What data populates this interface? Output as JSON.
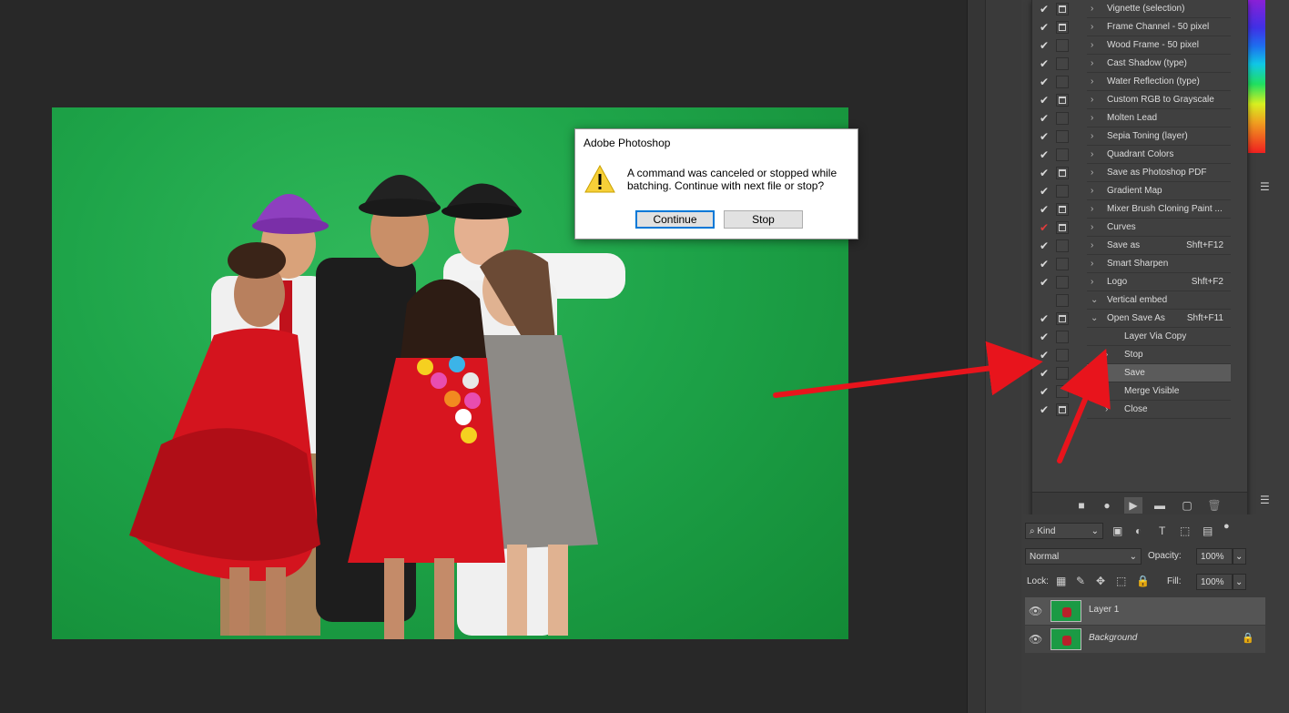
{
  "dialog": {
    "title": "Adobe Photoshop",
    "message": "A command was canceled or stopped while batching. Continue with next file or stop?",
    "continue_label": "Continue",
    "stop_label": "Stop"
  },
  "actions": [
    {
      "label": "Vignette (selection)",
      "shortcut": "",
      "check": true,
      "dialog": true,
      "arrow": "›",
      "indent": 0
    },
    {
      "label": "Frame Channel - 50 pixel",
      "shortcut": "",
      "check": true,
      "dialog": true,
      "arrow": "›",
      "indent": 0
    },
    {
      "label": "Wood Frame - 50 pixel",
      "shortcut": "",
      "check": true,
      "dialog": false,
      "arrow": "›",
      "indent": 0
    },
    {
      "label": "Cast Shadow (type)",
      "shortcut": "",
      "check": true,
      "dialog": false,
      "arrow": "›",
      "indent": 0
    },
    {
      "label": "Water Reflection (type)",
      "shortcut": "",
      "check": true,
      "dialog": false,
      "arrow": "›",
      "indent": 0
    },
    {
      "label": "Custom RGB to Grayscale",
      "shortcut": "",
      "check": true,
      "dialog": true,
      "arrow": "›",
      "indent": 0
    },
    {
      "label": "Molten Lead",
      "shortcut": "",
      "check": true,
      "dialog": false,
      "arrow": "›",
      "indent": 0
    },
    {
      "label": "Sepia Toning (layer)",
      "shortcut": "",
      "check": true,
      "dialog": false,
      "arrow": "›",
      "indent": 0
    },
    {
      "label": "Quadrant Colors",
      "shortcut": "",
      "check": true,
      "dialog": false,
      "arrow": "›",
      "indent": 0
    },
    {
      "label": "Save as Photoshop PDF",
      "shortcut": "",
      "check": true,
      "dialog": true,
      "arrow": "›",
      "indent": 0
    },
    {
      "label": "Gradient Map",
      "shortcut": "",
      "check": true,
      "dialog": false,
      "arrow": "›",
      "indent": 0
    },
    {
      "label": "Mixer Brush Cloning Paint ...",
      "shortcut": "",
      "check": true,
      "dialog": true,
      "arrow": "›",
      "indent": 0
    },
    {
      "label": "Curves",
      "shortcut": "",
      "check": true,
      "checkRed": true,
      "dialog": true,
      "arrow": "›",
      "indent": 0
    },
    {
      "label": "Save as",
      "shortcut": "Shft+F12",
      "check": true,
      "dialog": false,
      "arrow": "›",
      "indent": 0
    },
    {
      "label": "Smart Sharpen",
      "shortcut": "",
      "check": true,
      "dialog": false,
      "arrow": "›",
      "indent": 0
    },
    {
      "label": "Logo",
      "shortcut": "Shft+F2",
      "check": true,
      "dialog": false,
      "arrow": "›",
      "indent": 0
    },
    {
      "label": "Vertical embed",
      "shortcut": "",
      "check": false,
      "dialog": false,
      "arrow": "⌄",
      "indent": 0
    },
    {
      "label": "Open Save As",
      "shortcut": "Shft+F11",
      "check": true,
      "dialog": true,
      "arrow": "⌄",
      "indent": 0
    },
    {
      "label": "Layer Via Copy",
      "shortcut": "",
      "check": true,
      "dialog": false,
      "arrow": "",
      "indent": 1
    },
    {
      "label": "Stop",
      "shortcut": "",
      "check": true,
      "dialog": false,
      "arrow": "›",
      "indent": 1
    },
    {
      "label": "Save",
      "shortcut": "",
      "check": true,
      "dialog": false,
      "arrow": "›",
      "indent": 1,
      "selected": true
    },
    {
      "label": "Merge Visible",
      "shortcut": "",
      "check": true,
      "dialog": false,
      "arrow": "",
      "indent": 1
    },
    {
      "label": "Close",
      "shortcut": "",
      "check": true,
      "dialog": true,
      "arrow": "›",
      "indent": 1
    }
  ],
  "layers": {
    "kind_label": "Kind",
    "blend_mode": "Normal",
    "opacity_label": "Opacity:",
    "opacity_value": "100%",
    "lock_label": "Lock:",
    "fill_label": "Fill:",
    "fill_value": "100%",
    "items": [
      {
        "name": "Layer 1",
        "italic": false,
        "locked": false,
        "selected": true
      },
      {
        "name": "Background",
        "italic": true,
        "locked": true,
        "selected": false
      }
    ]
  },
  "colors": {
    "accent_blue": "#0078d7",
    "arrow_red": "#e8141c",
    "panel_bg": "#404040",
    "selected_row": "#5b5b5b"
  }
}
